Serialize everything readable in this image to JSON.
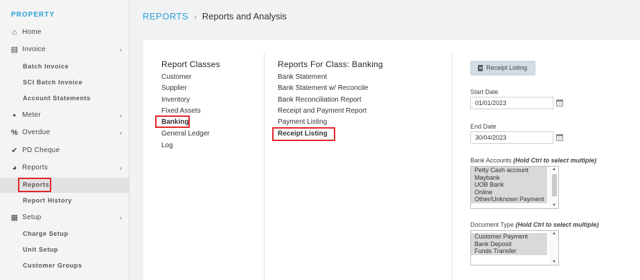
{
  "sidebar": {
    "title": "PROPERTY",
    "items": [
      {
        "label": "Home",
        "icon": "home-icon",
        "glyph": "⌂"
      },
      {
        "label": "Invoice",
        "icon": "document-icon",
        "glyph": "▤"
      },
      {
        "label": "Batch Invoice"
      },
      {
        "label": "SCI Batch Invoice"
      },
      {
        "label": "Account Statements"
      },
      {
        "label": "Meter",
        "icon": "drop-icon",
        "glyph": "●"
      },
      {
        "label": "Overdue",
        "icon": "percent-icon",
        "glyph": "%"
      },
      {
        "label": "PD Cheque",
        "icon": "check-icon",
        "glyph": "✔"
      },
      {
        "label": "Reports",
        "icon": "pie-chart-icon",
        "glyph": "◕"
      },
      {
        "label": "Reports"
      },
      {
        "label": "Report History"
      },
      {
        "label": "Setup",
        "icon": "grid-icon",
        "glyph": "▦"
      },
      {
        "label": "Charge Setup"
      },
      {
        "label": "Unit Setup"
      },
      {
        "label": "Customer Groups"
      }
    ],
    "chevron": "›"
  },
  "breadcrumb": {
    "root": "REPORTS",
    "separator": "›",
    "current": "Reports and Analysis"
  },
  "report_classes": {
    "heading": "Report Classes",
    "items": [
      "Customer",
      "Supplier",
      "Inventory",
      "Fixed Assets",
      "Banking",
      "General Ledger",
      "Log"
    ]
  },
  "reports_for_class": {
    "heading": "Reports For Class:  Banking",
    "items": [
      "Bank Statement",
      "Bank Statement w/ Reconcile",
      "Bank Reconciliation Report",
      "Receipt and Payment Report",
      "Payment Listing",
      "Receipt Listing"
    ]
  },
  "form": {
    "button_label": "Receipt Listing",
    "start_date_label": "Start Date",
    "start_date_value": "01/01/2023",
    "end_date_label": "End Date",
    "end_date_value": "30/04/2023",
    "bank_accounts_label": "Bank Accounts ",
    "bank_accounts_hint": "(Hold Ctrl to select multiple)",
    "bank_accounts": [
      "Petty Cash account",
      "Maybank",
      "UOB Bank",
      "Online",
      "Other/Unknown Payment"
    ],
    "document_type_label": "Document Type ",
    "document_type_hint": "(Hold Ctrl to select multiple)",
    "document_types": [
      "Customer Payment",
      "Bank Deposit",
      "Funds Transfer"
    ]
  },
  "colors": {
    "accent": "#2a9fd8",
    "highlight": "#e0242a"
  }
}
